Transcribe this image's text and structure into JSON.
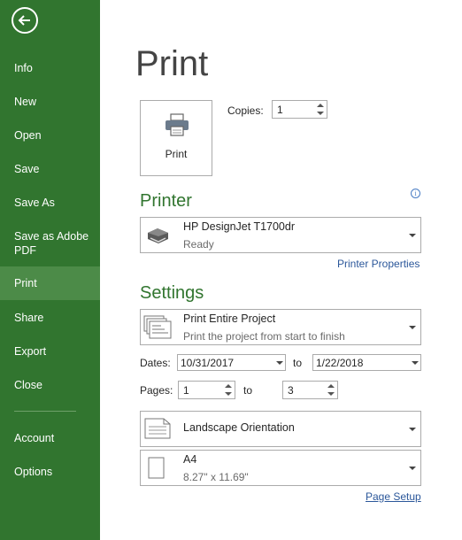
{
  "sidebar": {
    "items": [
      {
        "label": "Info"
      },
      {
        "label": "New"
      },
      {
        "label": "Open"
      },
      {
        "label": "Save"
      },
      {
        "label": "Save As"
      },
      {
        "label": "Save as Adobe PDF"
      },
      {
        "label": "Print",
        "active": true
      },
      {
        "label": "Share"
      },
      {
        "label": "Export"
      },
      {
        "label": "Close"
      },
      {
        "label": "Account"
      },
      {
        "label": "Options"
      }
    ]
  },
  "page_title": "Print",
  "print_button_label": "Print",
  "copies": {
    "label": "Copies:",
    "value": "1"
  },
  "printer": {
    "section_title": "Printer",
    "name": "HP DesignJet T1700dr",
    "status": "Ready",
    "properties_link": "Printer Properties"
  },
  "settings": {
    "section_title": "Settings",
    "scope": {
      "title": "Print Entire Project",
      "subtitle": "Print the project from start to finish"
    },
    "dates": {
      "label": "Dates:",
      "from": "10/31/2017",
      "to_label": "to",
      "to": "1/22/2018"
    },
    "pages": {
      "label": "Pages:",
      "from": "1",
      "to_label": "to",
      "to": "3"
    },
    "orientation": "Landscape Orientation",
    "paper": {
      "name": "A4",
      "size": "8.27\" x 11.69\""
    },
    "page_setup_link": "Page Setup"
  },
  "colors": {
    "sidebar": "#31752f",
    "accent": "#31752f",
    "active": "#4c8b48",
    "link": "#2b579a"
  }
}
